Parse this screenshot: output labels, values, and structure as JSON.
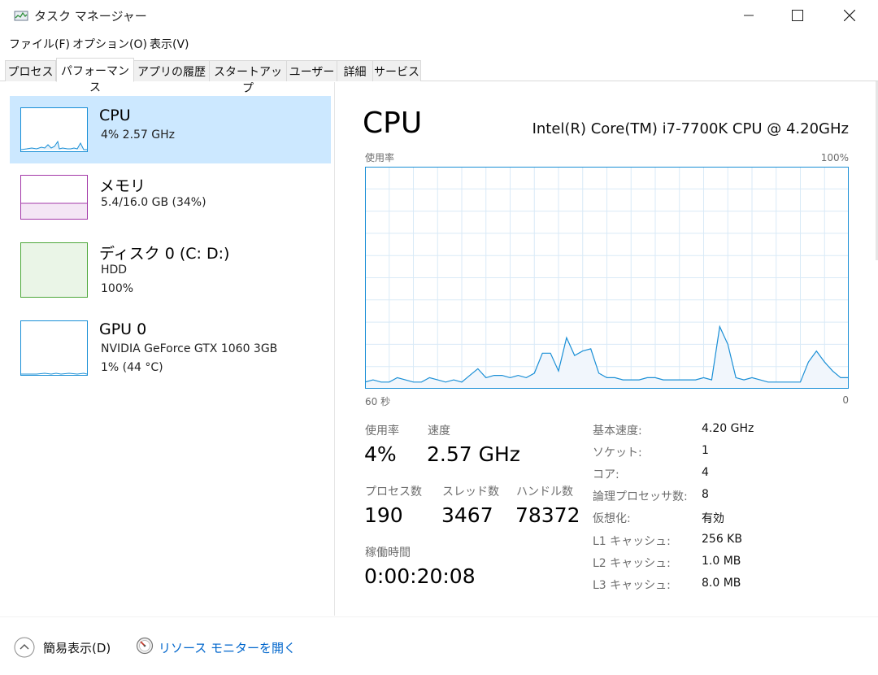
{
  "window": {
    "title": "タスク マネージャー",
    "icon": "task-manager-icon"
  },
  "menu": [
    "ファイル(F)",
    "オプション(O)",
    "表示(V)"
  ],
  "tabs": [
    "プロセス",
    "パフォーマンス",
    "アプリの履歴",
    "スタートアップ",
    "ユーザー",
    "詳細",
    "サービス"
  ],
  "active_tab": "パフォーマンス",
  "sidebar": {
    "items": [
      {
        "title": "CPU",
        "line1": "4%  2.57 GHz",
        "line2": "",
        "color": "#1a8fd6",
        "selected": true
      },
      {
        "title": "メモリ",
        "line1": "5.4/16.0 GB (34%)",
        "line2": "",
        "color": "#a338a8",
        "selected": false
      },
      {
        "title": "ディスク 0 (C: D:)",
        "line1": "HDD",
        "line2": "100%",
        "color": "#4da83a",
        "selected": false
      },
      {
        "title": "GPU 0",
        "line1": "NVIDIA GeForce GTX 1060 3GB",
        "line2": "1%  (44 °C)",
        "color": "#1a8fd6",
        "selected": false
      }
    ]
  },
  "detail": {
    "title": "CPU",
    "model": "Intel(R) Core(TM) i7-7700K CPU @ 4.20GHz",
    "graph_top_left": "使用率",
    "graph_top_right": "100%",
    "graph_bottom_left": "60 秒",
    "graph_bottom_right": "0",
    "stats": {
      "usage_label": "使用率",
      "usage_value": "4%",
      "speed_label": "速度",
      "speed_value": "2.57 GHz",
      "processes_label": "プロセス数",
      "processes_value": "190",
      "threads_label": "スレッド数",
      "threads_value": "3467",
      "handles_label": "ハンドル数",
      "handles_value": "78372",
      "uptime_label": "稼働時間",
      "uptime_value": "0:00:20:08"
    },
    "specs": [
      {
        "label": "基本速度:",
        "value": "4.20 GHz"
      },
      {
        "label": "ソケット:",
        "value": "1"
      },
      {
        "label": "コア:",
        "value": "4"
      },
      {
        "label": "論理プロセッサ数:",
        "value": "8"
      },
      {
        "label": "仮想化:",
        "value": "有効"
      },
      {
        "label": "L1 キャッシュ:",
        "value": "256 KB"
      },
      {
        "label": "L2 キャッシュ:",
        "value": "1.0 MB"
      },
      {
        "label": "L3 キャッシュ:",
        "value": "8.0 MB"
      }
    ]
  },
  "footer": {
    "fewer_details": "簡易表示(D)",
    "resource_monitor": "リソース モニターを開く"
  },
  "chart_data": {
    "type": "area",
    "x_range": [
      60,
      0
    ],
    "ylim": [
      0,
      100
    ],
    "grid": true,
    "color": "#1a8fd6",
    "values": [
      3,
      4,
      3,
      3,
      5,
      4,
      3,
      3,
      5,
      4,
      3,
      4,
      3,
      6,
      9,
      5,
      6,
      6,
      5,
      6,
      5,
      7,
      16,
      16,
      8,
      23,
      15,
      17,
      18,
      7,
      5,
      5,
      4,
      4,
      4,
      5,
      5,
      4,
      4,
      4,
      4,
      4,
      5,
      4,
      28,
      20,
      5,
      4,
      5,
      4,
      3,
      3,
      3,
      3,
      3,
      12,
      17,
      12,
      8,
      5,
      5
    ]
  }
}
